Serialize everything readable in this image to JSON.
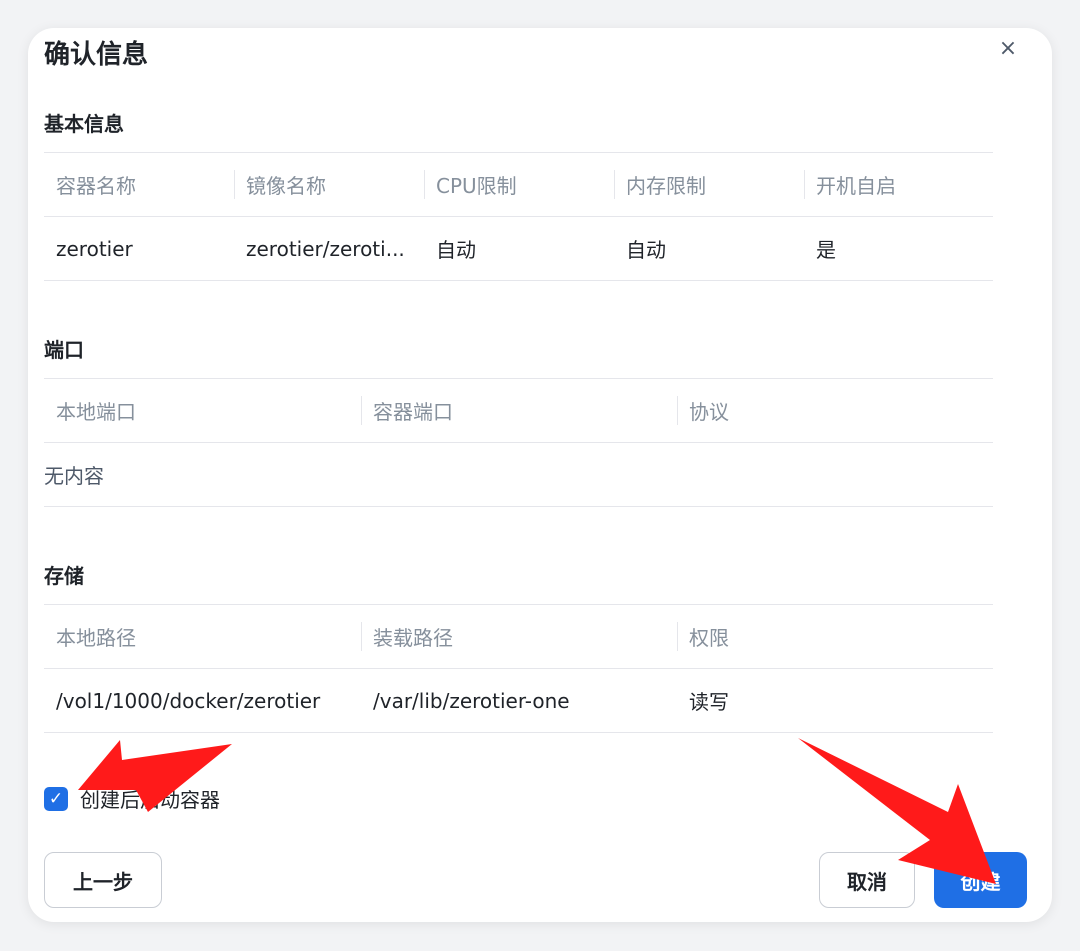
{
  "dialog": {
    "title": "确认信息",
    "close_icon": "×"
  },
  "basic": {
    "title": "基本信息",
    "headers": [
      "容器名称",
      "镜像名称",
      "CPU限制",
      "内存限制",
      "开机自启"
    ],
    "row": [
      "zerotier",
      "zerotier/zeroti...",
      "自动",
      "自动",
      "是"
    ]
  },
  "ports": {
    "title": "端口",
    "headers": [
      "本地端口",
      "容器端口",
      "协议"
    ],
    "empty_text": "无内容"
  },
  "storage": {
    "title": "存储",
    "headers": [
      "本地路径",
      "装载路径",
      "权限"
    ],
    "row": [
      "/vol1/1000/docker/zerotier",
      "/var/lib/zerotier-one",
      "读写"
    ]
  },
  "start_after_create": {
    "checked": true,
    "label": "创建后启动容器"
  },
  "buttons": {
    "prev": "上一步",
    "cancel": "取消",
    "create": "创建"
  },
  "colors": {
    "primary": "#1f6fe5",
    "annotation_arrow": "#ff1a1a"
  }
}
